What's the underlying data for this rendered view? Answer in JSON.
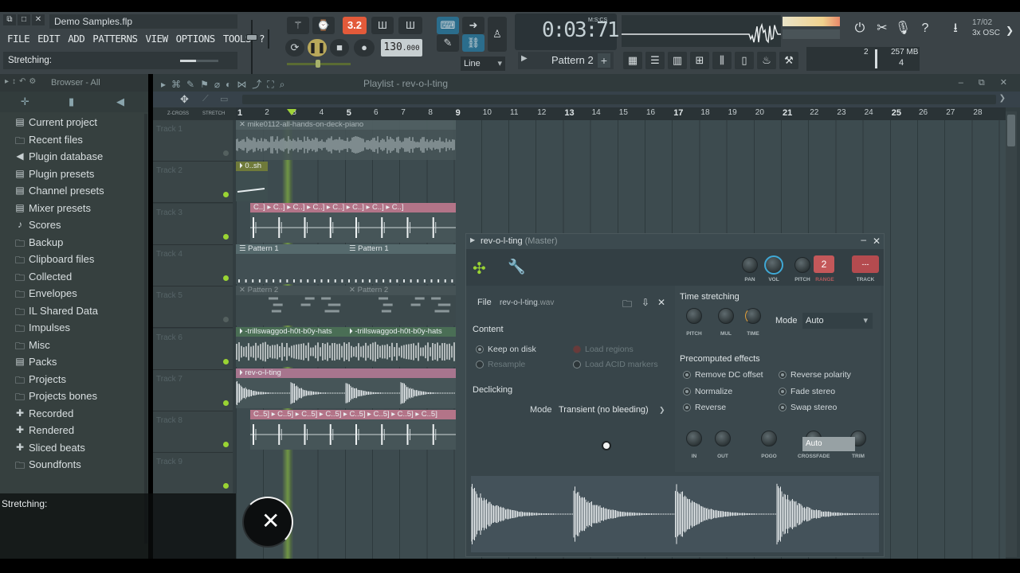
{
  "window": {
    "title": "Demo Samples.flp",
    "buttons": [
      "⧉",
      "□",
      "✕"
    ]
  },
  "menu": [
    "FILE",
    "EDIT",
    "ADD",
    "PATTERNS",
    "VIEW",
    "OPTIONS",
    "TOOLS",
    "?"
  ],
  "hint": {
    "text": "Stretching:"
  },
  "transport": {
    "rec_count": "3.2",
    "tempo": "130",
    "tempo_decimal": ".000",
    "snap": "Line",
    "time": "0:03",
    "time_frac": "71",
    "time_unit": "M:S:CS",
    "pattern": "Pattern 2",
    "pattern_plus": "+"
  },
  "news": {
    "date": "17/02",
    "title": "3x OSC"
  },
  "performance": {
    "cpu": "2",
    "memory": "257 MB",
    "polyphony": "4"
  },
  "browser": {
    "title": "Browser - All",
    "items": [
      {
        "label": "Current project",
        "icon": "▤"
      },
      {
        "label": "Recent files",
        "icon": "🗀"
      },
      {
        "label": "Plugin database",
        "icon": "◀"
      },
      {
        "label": "Plugin presets",
        "icon": "▤"
      },
      {
        "label": "Channel presets",
        "icon": "▤"
      },
      {
        "label": "Mixer presets",
        "icon": "▤"
      },
      {
        "label": "Scores",
        "icon": "♪"
      },
      {
        "label": "Backup",
        "icon": "🗀"
      },
      {
        "label": "Clipboard files",
        "icon": "🗀"
      },
      {
        "label": "Collected",
        "icon": "🗀"
      },
      {
        "label": "Envelopes",
        "icon": "🗀"
      },
      {
        "label": "IL Shared Data",
        "icon": "🗀"
      },
      {
        "label": "Impulses",
        "icon": "🗀"
      },
      {
        "label": "Misc",
        "icon": "🗀"
      },
      {
        "label": "Packs",
        "icon": "▤"
      },
      {
        "label": "Projects",
        "icon": "🗀"
      },
      {
        "label": "Projects bones",
        "icon": "🗀"
      },
      {
        "label": "Recorded",
        "icon": "✚"
      },
      {
        "label": "Rendered",
        "icon": "✚"
      },
      {
        "label": "Sliced beats",
        "icon": "✚"
      },
      {
        "label": "Soundfonts",
        "icon": "🗀"
      }
    ]
  },
  "playlist": {
    "title": "Playlist - rev-o-l-ting",
    "ruler_head": [
      "Z-CROSS",
      "STRETCH"
    ],
    "bars": [
      "1",
      "2",
      "3",
      "4",
      "5",
      "6",
      "7",
      "8",
      "9",
      "10",
      "11",
      "12",
      "13",
      "14",
      "15",
      "16",
      "17",
      "18",
      "19",
      "20",
      "21",
      "22",
      "23",
      "24",
      "25",
      "26",
      "27",
      "28"
    ],
    "tracks": [
      "Track 1",
      "Track 2",
      "Track 3",
      "Track 4",
      "Track 5",
      "Track 6",
      "Track 7",
      "Track 8",
      "Track 9"
    ],
    "clips": [
      {
        "label": "mike0112-all-hands-on-deck-piano"
      },
      {
        "label": "0..sh"
      },
      {
        "label": "C..] ▸ C..] ▸ C..] ▸ C..] ▸ C..] ▸ C..] ▸ C..] ▸ C..]"
      },
      {
        "label": "Pattern 1"
      },
      {
        "label": "Pattern 1"
      },
      {
        "label": "Pattern 2"
      },
      {
        "label": "Pattern 2"
      },
      {
        "label": "-trillswaggod-h0t-b0y-hats"
      },
      {
        "label": "-trillswaggod-h0t-b0y-hats"
      },
      {
        "label": "rev-o-l-ting"
      },
      {
        "label": "C..5] ▸ C..5] ▸ C..5] ▸ C..5] ▸ C..5] ▸ C..5] ▸ C..5] ▸ C..5]"
      }
    ]
  },
  "channel": {
    "title": "rev-o-l-ting",
    "title_sub": "(Master)",
    "knobs": {
      "pan": "PAN",
      "vol": "VOL",
      "pitch": "PITCH",
      "range": "RANGE",
      "track": "TRACK"
    },
    "pitch_range_value": "2",
    "track_value": "---",
    "file_label": "File",
    "file_name": "rev-o-l-ting",
    "file_ext": ".wav",
    "content_title": "Content",
    "keep_on_disk": "Keep on disk",
    "load_regions": "Load regions",
    "resample": "Resample",
    "load_acid": "Load ACID markers",
    "declicking_title": "Declicking",
    "declick_mode_label": "Mode",
    "declick_mode_value": "Transient (no bleeding)",
    "time_stretching_title": "Time stretching",
    "ts_knobs": [
      "PITCH",
      "MUL",
      "TIME"
    ],
    "ts_mode_label": "Mode",
    "ts_mode_value": "Auto",
    "precomputed_title": "Precomputed effects",
    "effects_left": [
      "Remove DC offset",
      "Normalize",
      "Reverse"
    ],
    "effects_right": [
      "Reverse polarity",
      "Fade stereo",
      "Swap stereo"
    ],
    "bottom_knobs": [
      "IN",
      "OUT",
      "POGO",
      "CROSSFADE",
      "TRIM"
    ],
    "crossfade_overlay": "Auto"
  },
  "overlay": {
    "text": "Stretching:"
  }
}
